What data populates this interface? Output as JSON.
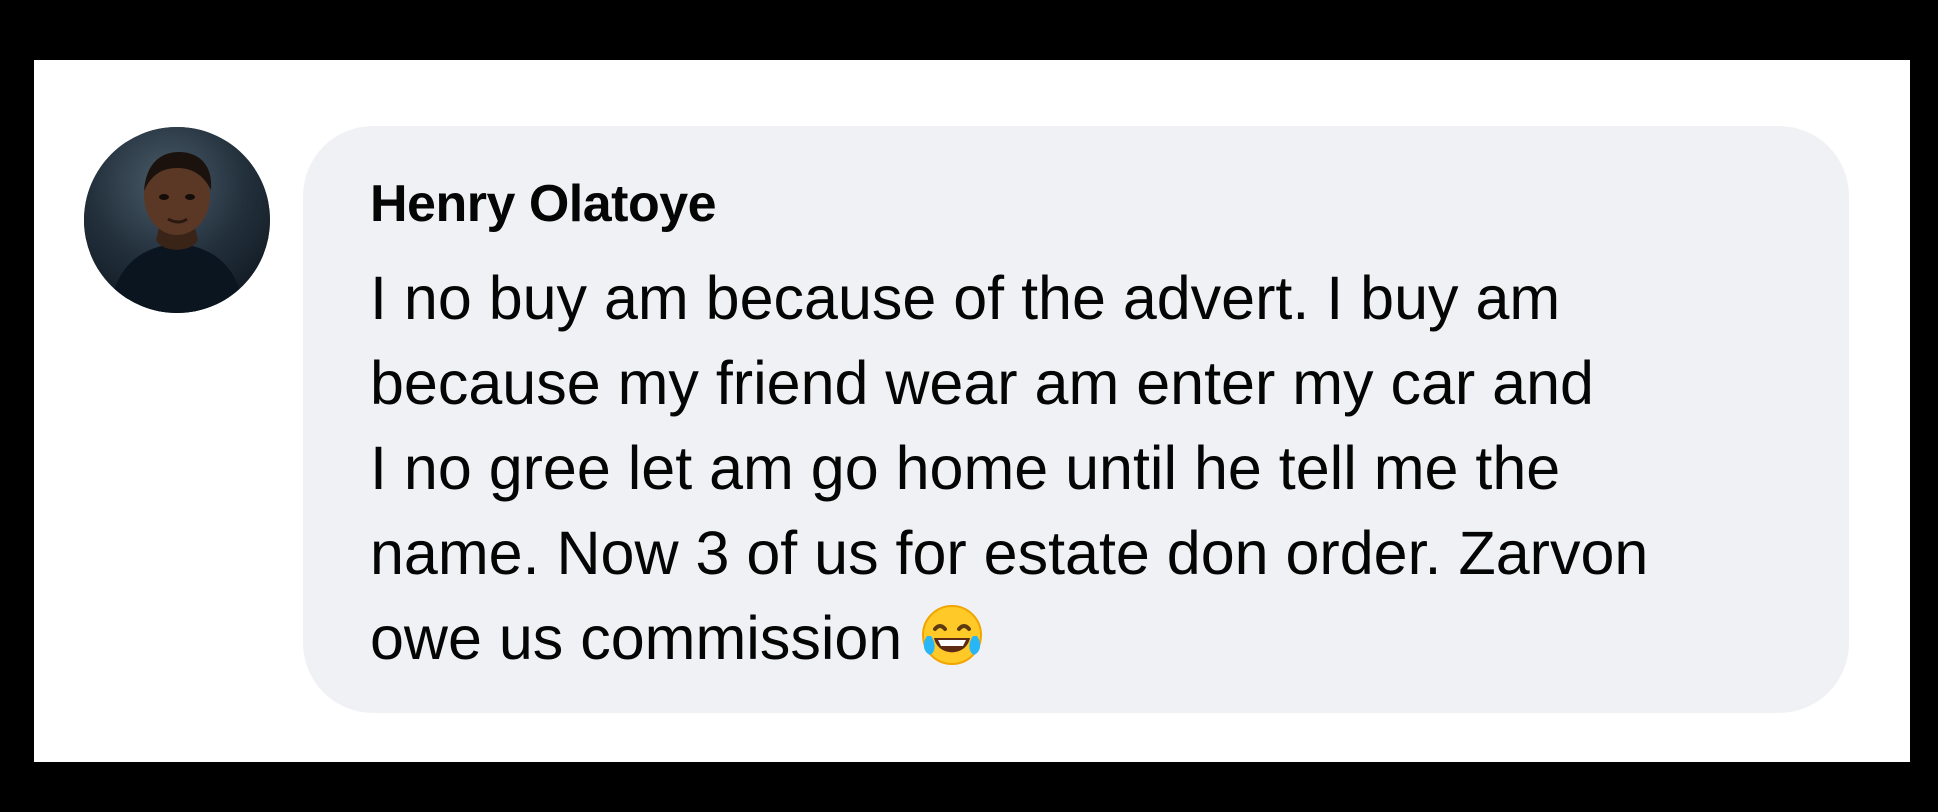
{
  "comment": {
    "author": "Henry Olatoye",
    "lines": [
      "I no buy am because of the advert. I buy am",
      "because my friend wear am enter my car and",
      "I no gree let am go home until he tell me the",
      "name. Now 3 of us for estate don order. Zarvon",
      "owe us commission"
    ],
    "emoji": "face-with-tears-of-joy-icon"
  },
  "colors": {
    "background": "#000000",
    "card": "#ffffff",
    "bubble": "#f0f1f4",
    "text": "#050505"
  }
}
